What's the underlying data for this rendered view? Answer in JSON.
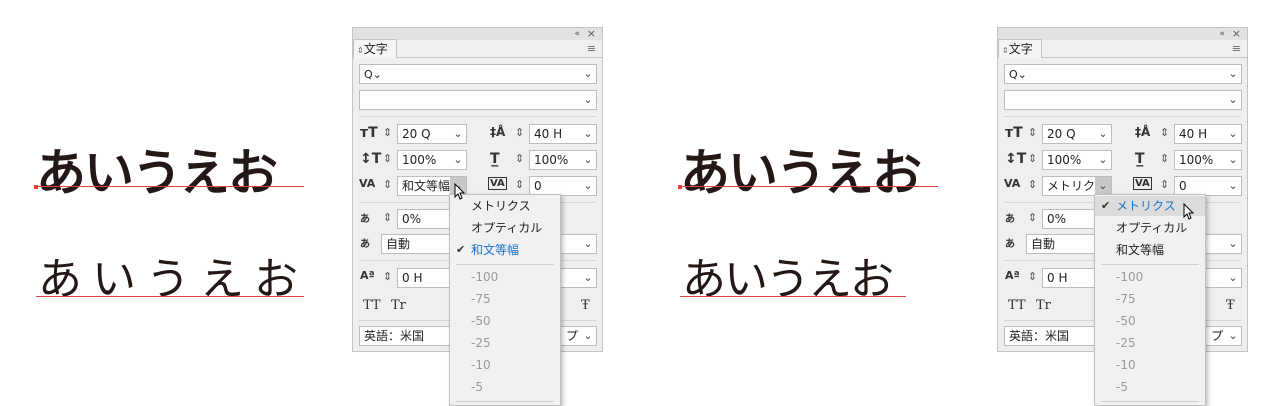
{
  "samples": {
    "text": "あいうえお"
  },
  "panel": {
    "collapse_glyph": "«",
    "close_glyph": "×",
    "tab_arrow": "⇕",
    "tab_label": "文字",
    "menu_glyph": "≡",
    "font_search_icon": "Q⌄",
    "font_size": "20 Q",
    "leading": "40 H",
    "vertical_scale": "100%",
    "horizontal_scale": "100%",
    "tracking": "0",
    "tsume": "0%",
    "aki": "自動",
    "baseline_shift": "0 H",
    "tt_all_caps": "TT",
    "tt_small_caps": "Tr",
    "tt_strike": "Ŧ",
    "language": "英語：米国",
    "trailing_fragment": "プ"
  },
  "left_panel": {
    "kerning_value": "和文等幅"
  },
  "right_panel": {
    "kerning_value": "メトリクス"
  },
  "kerning_menu": {
    "options": [
      "メトリクス",
      "オプティカル",
      "和文等幅"
    ],
    "numeric_options": [
      "-100",
      "-75",
      "-50",
      "-25",
      "-10",
      "-5"
    ],
    "check_glyph": "✔",
    "left_selected": "和文等幅",
    "right_selected": "メトリクス"
  },
  "colors": {
    "accent_blue": "#1a73c8",
    "baseline_red": "#e04040",
    "sample_text": "#231815"
  }
}
